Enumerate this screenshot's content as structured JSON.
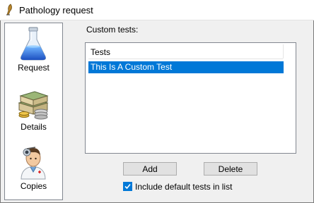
{
  "window": {
    "title": "Pathology request"
  },
  "nav": {
    "items": [
      {
        "label": "Request",
        "icon": "flask-icon"
      },
      {
        "label": "Details",
        "icon": "money-stack-icon"
      },
      {
        "label": "Copies",
        "icon": "doctor-icon"
      }
    ]
  },
  "main": {
    "custom_tests_label": "Custom tests:",
    "list": {
      "column_header": "Tests",
      "rows": [
        "This Is A Custom Test"
      ],
      "selected_index": 0
    },
    "add_label": "Add",
    "delete_label": "Delete",
    "include_default": {
      "label": "Include default tests in list",
      "checked": true
    }
  },
  "colors": {
    "selection": "#0078d7",
    "window_bg": "#f0f0f0"
  }
}
